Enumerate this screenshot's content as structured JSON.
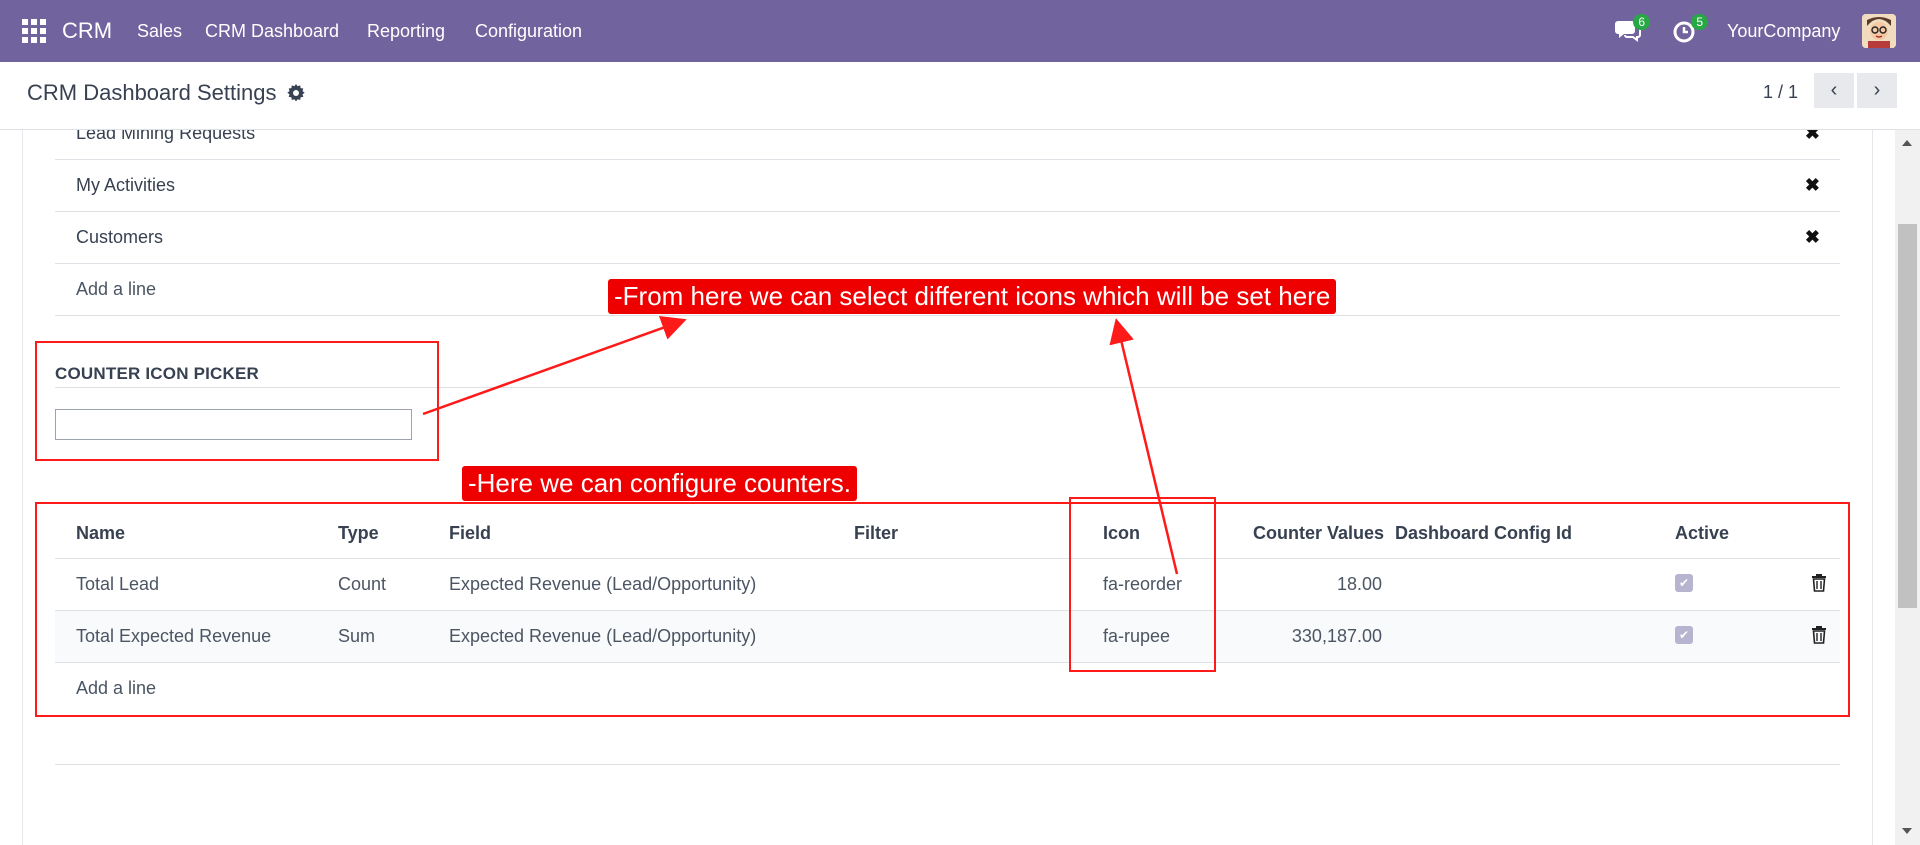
{
  "navbar": {
    "brand": "CRM",
    "menu": [
      "Sales",
      "CRM Dashboard",
      "Reporting",
      "Configuration"
    ],
    "messages_badge": "6",
    "activities_badge": "5",
    "company": "YourCompany"
  },
  "control_panel": {
    "title": "CRM Dashboard Settings",
    "pager": "1 / 1"
  },
  "top_list": {
    "rows": [
      {
        "label": "Lead Mining Requests"
      },
      {
        "label": "My Activities"
      },
      {
        "label": "Customers"
      }
    ],
    "add_line": "Add a line"
  },
  "counter_icon_picker": {
    "title": "COUNTER ICON PICKER",
    "value": ""
  },
  "counters_table": {
    "headers": [
      "Name",
      "Type",
      "Field",
      "Filter",
      "Icon",
      "Counter Values",
      "Dashboard Config Id",
      "Active"
    ],
    "rows": [
      {
        "name": "Total Lead",
        "type": "Count",
        "field": "Expected Revenue (Lead/Opportunity)",
        "filter": "",
        "icon": "fa-reorder",
        "counter_values": "18.00",
        "config_id": "",
        "active": true
      },
      {
        "name": "Total Expected Revenue",
        "type": "Sum",
        "field": "Expected Revenue (Lead/Opportunity)",
        "filter": "",
        "icon": "fa-rupee",
        "counter_values": "330,187.00",
        "config_id": "",
        "active": true
      }
    ],
    "add_line": "Add a line"
  },
  "annotations": {
    "callout_icons": "-From here we can select different icons which will be set here",
    "callout_counters": "-Here we can configure counters."
  },
  "colors": {
    "navbar": "#71639e",
    "annotation_red": "#ee0000",
    "badge_green": "#28a745"
  }
}
